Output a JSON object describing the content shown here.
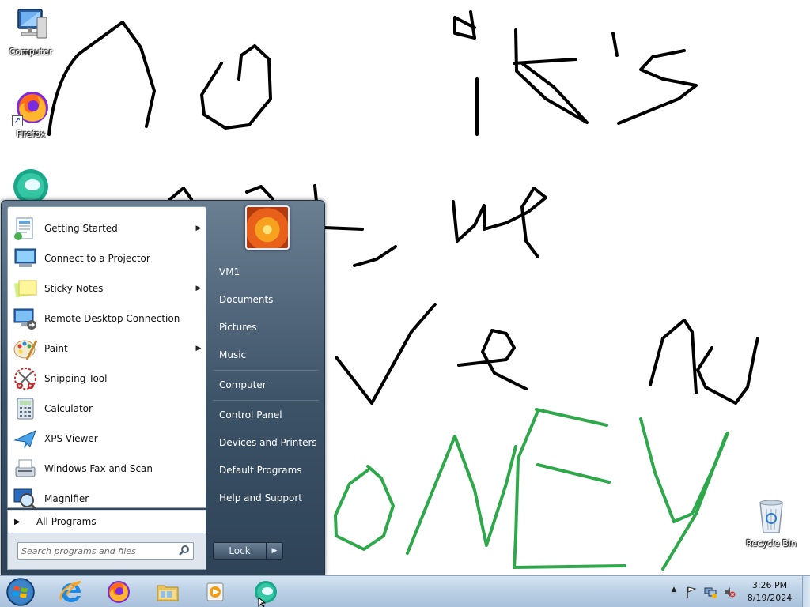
{
  "desktop": {
    "icons": [
      {
        "label": "Computer",
        "icon": "computer-icon"
      },
      {
        "label": "Firefox",
        "icon": "firefox-icon"
      },
      {
        "label": "",
        "icon": "app-icon"
      },
      {
        "label": "Recycle Bin",
        "icon": "recycle-bin-icon"
      }
    ],
    "scribble_colors": {
      "black": "#000000",
      "green": "#2ea84a"
    }
  },
  "start_menu": {
    "programs": [
      {
        "label": "Getting Started",
        "icon": "getting-started-icon",
        "has_submenu": true
      },
      {
        "label": "Connect to a Projector",
        "icon": "projector-icon",
        "has_submenu": false
      },
      {
        "label": "Sticky Notes",
        "icon": "sticky-notes-icon",
        "has_submenu": true
      },
      {
        "label": "Remote Desktop Connection",
        "icon": "remote-desktop-icon",
        "has_submenu": false
      },
      {
        "label": "Paint",
        "icon": "paint-icon",
        "has_submenu": true
      },
      {
        "label": "Snipping Tool",
        "icon": "scissors-icon",
        "has_submenu": false
      },
      {
        "label": "Calculator",
        "icon": "calculator-icon",
        "has_submenu": false
      },
      {
        "label": "XPS Viewer",
        "icon": "xps-viewer-icon",
        "has_submenu": false
      },
      {
        "label": "Windows Fax and Scan",
        "icon": "fax-scan-icon",
        "has_submenu": false
      },
      {
        "label": "Magnifier",
        "icon": "magnifier-icon",
        "has_submenu": false
      }
    ],
    "all_programs": "All Programs",
    "search_placeholder": "Search programs and files",
    "right_items": [
      {
        "label": "VM1"
      },
      {
        "label": "Documents"
      },
      {
        "label": "Pictures"
      },
      {
        "label": "Music"
      },
      {
        "label": "Computer"
      },
      {
        "label": "Control Panel"
      },
      {
        "label": "Devices and Printers"
      },
      {
        "label": "Default Programs"
      },
      {
        "label": "Help and Support"
      }
    ],
    "lock_label": "Lock",
    "accent": "#3c5266"
  },
  "taskbar": {
    "pinned": [
      {
        "name": "internet-explorer",
        "icon": "internet-explorer-icon"
      },
      {
        "name": "firefox",
        "icon": "firefox-icon"
      },
      {
        "name": "file-explorer",
        "icon": "folder-icon"
      },
      {
        "name": "media-player",
        "icon": "media-player-icon"
      },
      {
        "name": "app",
        "icon": "app-icon"
      }
    ],
    "clock": {
      "time": "3:26 PM",
      "date": "8/19/2024"
    }
  }
}
